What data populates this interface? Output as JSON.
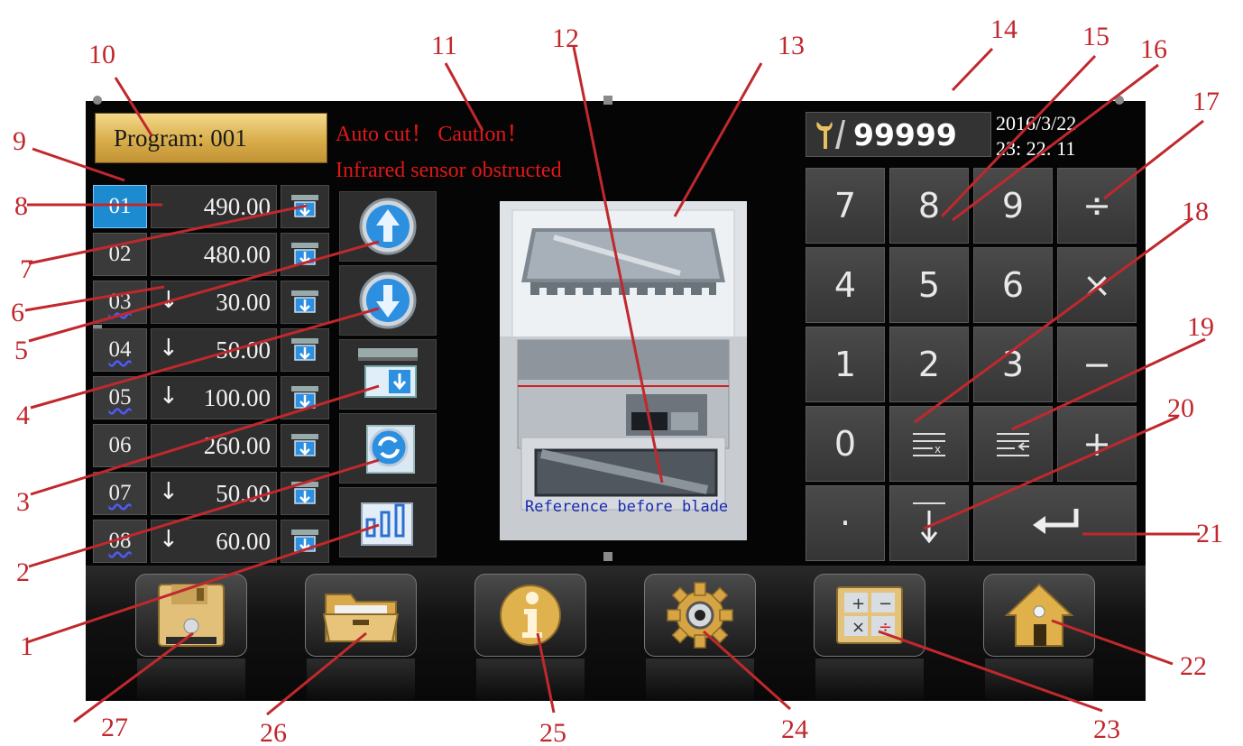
{
  "program": {
    "label": "Program: 001"
  },
  "alerts": [
    "Auto cut！ Caution！",
    "Infrared sensor obstructed"
  ],
  "steps": [
    {
      "num": "01",
      "value": "490.00",
      "arrow": ""
    },
    {
      "num": "02",
      "value": "480.00",
      "arrow": ""
    },
    {
      "num": "03",
      "value": "30.00",
      "arrow": "↓"
    },
    {
      "num": "04",
      "value": "50.00",
      "arrow": "↓"
    },
    {
      "num": "05",
      "value": "100.00",
      "arrow": "↓"
    },
    {
      "num": "06",
      "value": "260.00",
      "arrow": ""
    },
    {
      "num": "07",
      "value": "50.00",
      "arrow": "↓"
    },
    {
      "num": "08",
      "value": "60.00",
      "arrow": "↓"
    }
  ],
  "selected_step": "01",
  "machine": {
    "ref_text": "Reference  before blade"
  },
  "counter": {
    "value": "99999"
  },
  "datetime": {
    "date": "2016/3/22",
    "time": "23: 22: 11"
  },
  "keypad": {
    "keys": [
      "7",
      "8",
      "9",
      "÷",
      "4",
      "5",
      "6",
      "×",
      "1",
      "2",
      "3",
      "−",
      "0",
      "",
      "",
      "+",
      "·",
      "",
      "",
      ""
    ]
  },
  "callouts": [
    "1",
    "2",
    "3",
    "4",
    "5",
    "6",
    "7",
    "8",
    "9",
    "10",
    "11",
    "12",
    "13",
    "14",
    "15",
    "16",
    "17",
    "18",
    "19",
    "20",
    "21",
    "22",
    "23",
    "24",
    "25",
    "26",
    "27"
  ],
  "colors": {
    "accent_blue": "#1d8bd0",
    "alert_red": "#e01818",
    "callout_red": "#c0282d",
    "gold": "#d8ad4a"
  }
}
